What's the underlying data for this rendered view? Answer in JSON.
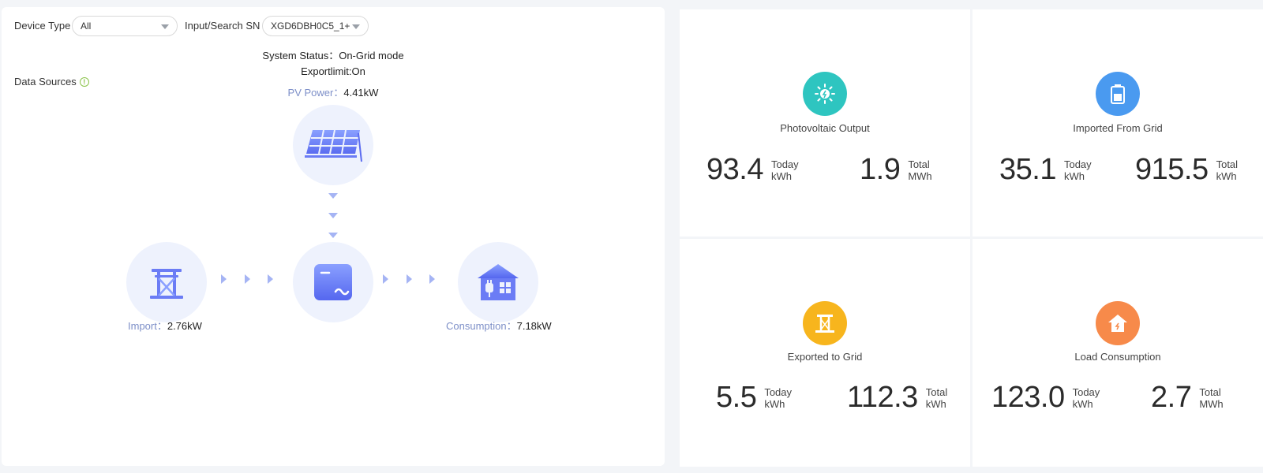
{
  "filters": {
    "device_type_label": "Device Type",
    "device_type_value": "All",
    "sn_label": "Input/Search SN",
    "sn_value": "XGD6DBH0C5_1+"
  },
  "status": {
    "system_status": "System Status：On-Grid mode",
    "export_limit": "Exportlimit:On"
  },
  "data_sources_label": "Data Sources",
  "flow": {
    "pv_label": "PV Power：",
    "pv_value": "4.41kW",
    "import_label": "Import：",
    "import_value": "2.76kW",
    "consumption_label": "Consumption：",
    "consumption_value": "7.18kW"
  },
  "colors": {
    "pv": "#2ec5c0",
    "import": "#4a9af0",
    "export": "#f7b51d",
    "load": "#f78a4a",
    "node_bg": "#eef2fd",
    "arrow": "#a5b4f4"
  },
  "cards": [
    {
      "title": "Photovoltaic Output",
      "icon": "sun-icon",
      "today_value": "93.4",
      "today_label": "Today",
      "today_unit": "kWh",
      "total_value": "1.9",
      "total_label": "Total",
      "total_unit": "MWh"
    },
    {
      "title": "Imported From Grid",
      "icon": "battery-icon",
      "today_value": "35.1",
      "today_label": "Today",
      "today_unit": "kWh",
      "total_value": "915.5",
      "total_label": "Total",
      "total_unit": "kWh"
    },
    {
      "title": "Exported to Grid",
      "icon": "tower-icon",
      "today_value": "5.5",
      "today_label": "Today",
      "today_unit": "kWh",
      "total_value": "112.3",
      "total_label": "Total",
      "total_unit": "kWh"
    },
    {
      "title": "Load Consumption",
      "icon": "home-icon",
      "today_value": "123.0",
      "today_label": "Today",
      "today_unit": "kWh",
      "total_value": "2.7",
      "total_label": "Total",
      "total_unit": "MWh"
    }
  ]
}
